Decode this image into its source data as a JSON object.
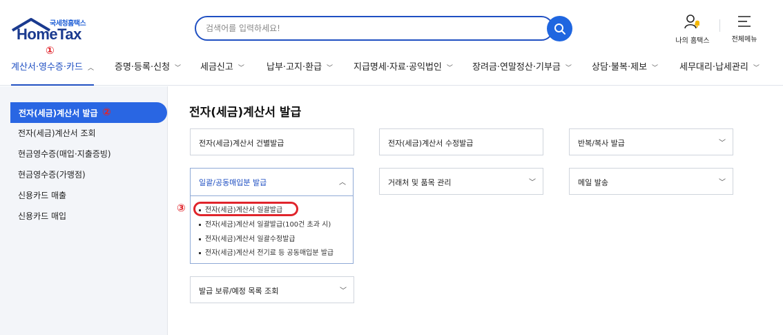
{
  "logo": {
    "sub": "국세청홈택스",
    "main": "HomeTax"
  },
  "search": {
    "placeholder": "검색어를 입력하세요!"
  },
  "util": {
    "my_label": "나의 홈택스",
    "all_label": "전체메뉴"
  },
  "annotations": {
    "m1": "①",
    "m2": "②",
    "m3": "③"
  },
  "gnb": [
    {
      "label": "계산서·영수증·카드"
    },
    {
      "label": "증명·등록·신청"
    },
    {
      "label": "세금신고"
    },
    {
      "label": "납부·고지·환급"
    },
    {
      "label": "지급명세·자료·공익법인"
    },
    {
      "label": "장려금·연말정산·기부금"
    },
    {
      "label": "상담·불복·제보"
    },
    {
      "label": "세무대리·납세관리"
    }
  ],
  "sidebar": {
    "items": [
      {
        "label": "전자(세금)계산서 발급"
      },
      {
        "label": "전자(세금)계산서 조회"
      },
      {
        "label": "현금영수증(매입·지출증빙)"
      },
      {
        "label": "현금영수증(가맹점)"
      },
      {
        "label": "신용카드 매출"
      },
      {
        "label": "신용카드 매입"
      }
    ]
  },
  "main": {
    "title": "전자(세금)계산서 발급",
    "cards": [
      {
        "label": "전자(세금)계산서 건별발급"
      },
      {
        "label": "전자(세금)계산서 수정발급"
      },
      {
        "label": "반복/복사 발급"
      },
      {
        "label": "일괄/공동매입분 발급"
      },
      {
        "label": "거래처 및 품목 관리"
      },
      {
        "label": "메일 발송"
      },
      {
        "label": "발급 보류/예정 목록 조회"
      }
    ],
    "dropdown": [
      {
        "label": "전자(세금)계산서 일괄발급"
      },
      {
        "label": "전자(세금)계산서 일괄발급(100건 초과 시)"
      },
      {
        "label": "전자(세금)계산서 일괄수정발급"
      },
      {
        "label": "전자(세금)계산서 전기료 등 공동매입분 발급"
      }
    ]
  },
  "colors": {
    "accent": "#1f4fc2",
    "active_bg": "#2966e3",
    "marker": "#e0242b"
  }
}
